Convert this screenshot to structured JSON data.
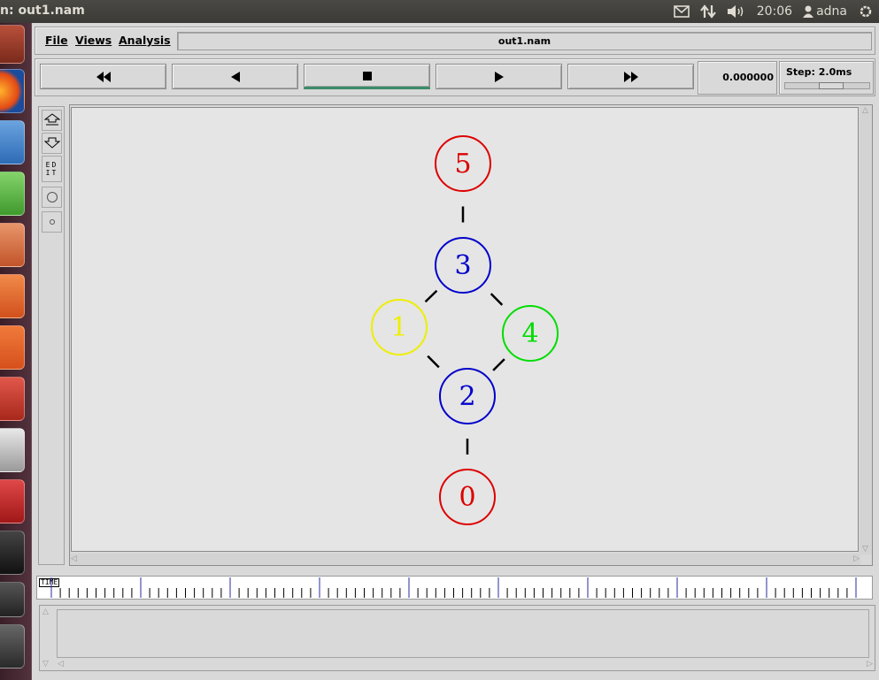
{
  "top_panel": {
    "window_title": "n: out1.nam",
    "clock": "20:06",
    "user": "adna"
  },
  "menu": {
    "file": "File",
    "views": "Views",
    "analysis": "Analysis",
    "filename": "out1.nam"
  },
  "controls": {
    "time": "0.000000",
    "step_label": "Step: 2.0ms",
    "active_button": "stop"
  },
  "timeline": {
    "label": "TIME"
  },
  "topology": {
    "nodes": [
      {
        "id": "5",
        "color": "#dd0000"
      },
      {
        "id": "3",
        "color": "#0000cc"
      },
      {
        "id": "1",
        "color": "#eeee00"
      },
      {
        "id": "4",
        "color": "#00dd00"
      },
      {
        "id": "2",
        "color": "#0000cc"
      },
      {
        "id": "0",
        "color": "#dd0000"
      }
    ],
    "links": [
      [
        "5",
        "3"
      ],
      [
        "3",
        "1"
      ],
      [
        "3",
        "4"
      ],
      [
        "1",
        "2"
      ],
      [
        "4",
        "2"
      ],
      [
        "2",
        "0"
      ]
    ]
  }
}
